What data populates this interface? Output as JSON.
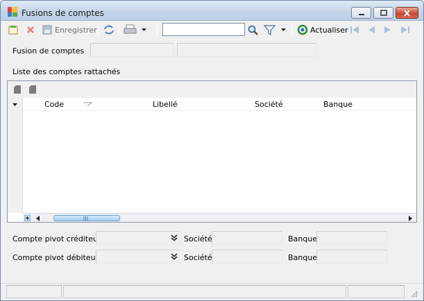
{
  "window": {
    "title": "Fusions de comptes"
  },
  "toolbar": {
    "save_label": "Enregistrer",
    "search_value": "",
    "refresh_label": "Actualiser"
  },
  "form": {
    "fusion_label": "Fusion de comptes",
    "fusion_code": "",
    "fusion_name": "",
    "list_title": "Liste des comptes rattachés"
  },
  "grid": {
    "columns": [
      "Code",
      "Libellé",
      "Société",
      "Banque"
    ],
    "rows": []
  },
  "pivots": {
    "creditor_label": "Compte pivot créditeur :",
    "debtor_label": "Compte pivot débiteur :",
    "company_label": "Société",
    "bank_label": "Banque",
    "creditor_value": "",
    "debtor_value": "",
    "creditor_company": "",
    "debtor_company": "",
    "creditor_bank": "",
    "debtor_bank": ""
  },
  "colors": {
    "title_bar": "#c6d6ea",
    "window_bg": "#f0f0f0",
    "scroll_thumb": "#a9d1f2"
  },
  "icons": {
    "app": "app-colors-icon",
    "new": "new-record-icon",
    "delete": "delete-icon",
    "save": "save-icon",
    "refresh": "refresh-icon",
    "print": "print-icon",
    "search": "search-icon",
    "filter": "filter-icon",
    "reload": "reload-icon",
    "first": "first-record-icon",
    "previous": "previous-record-icon",
    "next": "next-record-icon",
    "last": "last-record-icon"
  }
}
